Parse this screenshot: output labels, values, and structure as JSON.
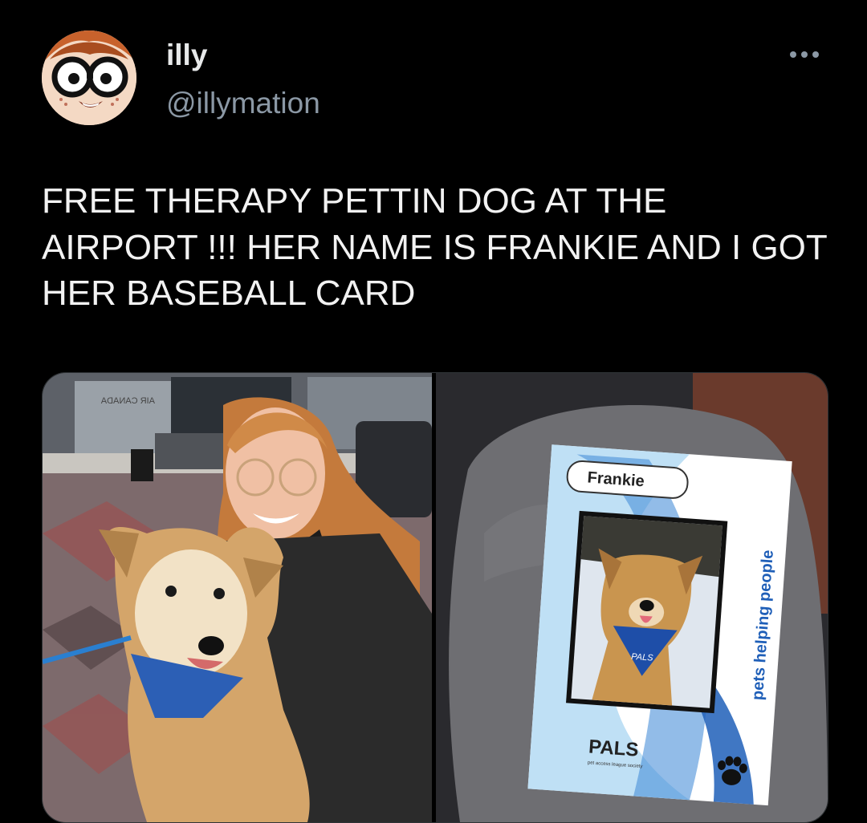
{
  "author": {
    "display_name": "illy",
    "handle": "@illymation",
    "avatar_icon": "cartoon-glasses-avatar-icon"
  },
  "more_icon": "more-options-icon",
  "tweet": {
    "text": "FREE THERAPY PETTIN DOG AT THE AIRPORT !!! HER NAME IS FRANKIE AND I GOT HER BASEBALL CARD"
  },
  "media": {
    "left_photo": {
      "sign_text": "AIR CANADA"
    },
    "right_photo": {
      "card_name": "Frankie",
      "card_side_text": "pets helping people",
      "bandana_text": "PALS",
      "logo_text": "PALS",
      "logo_subtext": "pet access league society"
    }
  },
  "colors": {
    "background": "#000000",
    "text_primary": "#e7e9ea",
    "text_secondary": "#8b98a5",
    "card_blue": "#1f5fb8"
  }
}
